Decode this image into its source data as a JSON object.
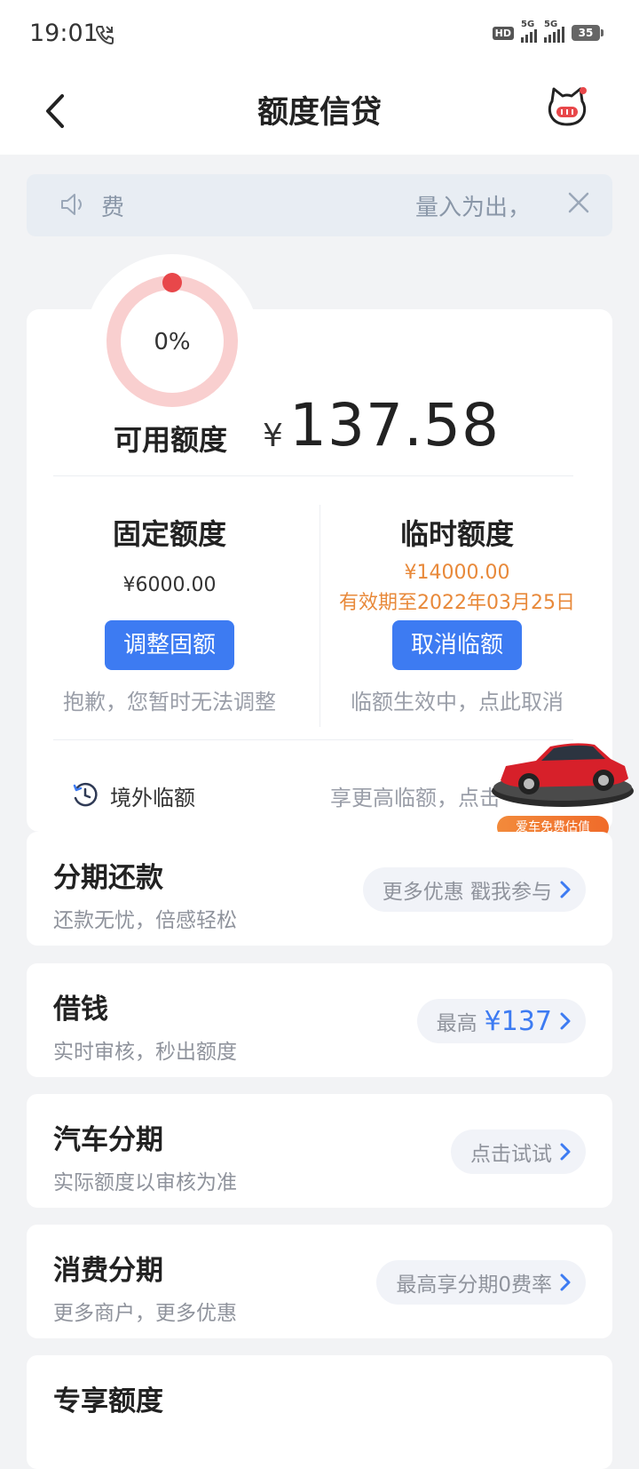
{
  "status_bar": {
    "time": "19:01",
    "hd_label": "HD",
    "net1": "5G",
    "net2": "5G",
    "battery": "35"
  },
  "nav": {
    "title": "额度信贷"
  },
  "notice": {
    "left_text": "费",
    "right_text": "量入为出，"
  },
  "credit": {
    "usage_percent": 0,
    "usage_label": "0%",
    "available_label": "可用额度",
    "currency_symbol": "¥",
    "available_amount": "137.58"
  },
  "fixed": {
    "title": "固定额度",
    "amount": "¥6000.00",
    "button": "调整固额",
    "note": "抱歉，您暂时无法调整"
  },
  "temporary": {
    "title": "临时额度",
    "amount": "¥14000.00",
    "expiry": "有效期至2022年03月25日",
    "button": "取消临额",
    "note": "临额生效中，点此取消"
  },
  "overseas": {
    "label": "境外临额",
    "promo": "享更高临额，点击"
  },
  "car_widget": {
    "badge": "爱车免费估值"
  },
  "list": [
    {
      "title": "分期还款",
      "subtitle": "还款无忧，倍感轻松",
      "pill": "更多优惠 戳我参与",
      "pill_value": ""
    },
    {
      "title": "借钱",
      "subtitle": "实时审核，秒出额度",
      "pill": "最高",
      "pill_value": "¥137"
    },
    {
      "title": "汽车分期",
      "subtitle": "实际额度以审核为准",
      "pill": "点击试试",
      "pill_value": ""
    },
    {
      "title": "消费分期",
      "subtitle": "更多商户，更多优惠",
      "pill": "最高享分期0费率",
      "pill_value": ""
    },
    {
      "title": "专享额度",
      "subtitle": "",
      "pill": "",
      "pill_value": ""
    }
  ],
  "colors": {
    "accent": "#3d7bf2",
    "orange": "#e8893a",
    "gauge_track": "#f9cfcf",
    "gauge_dot": "#e8474a"
  }
}
